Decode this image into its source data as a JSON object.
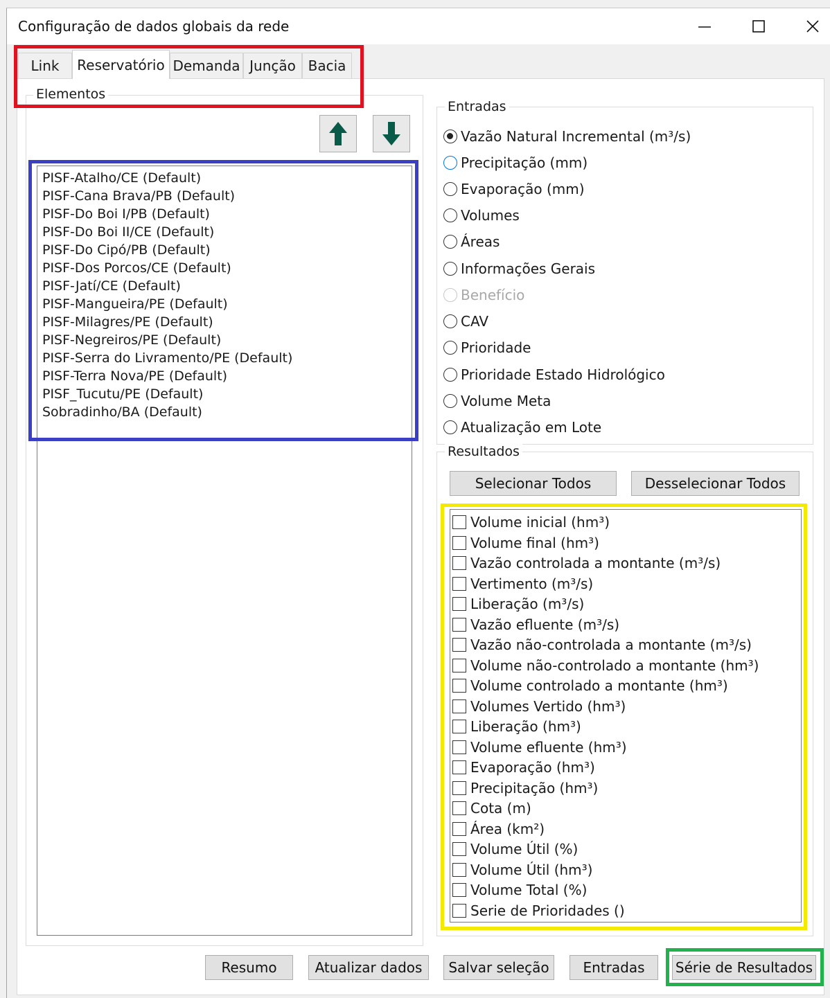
{
  "window": {
    "title": "Configuração de dados globais da rede",
    "controls": {
      "minimize": "—",
      "maximize": "☐",
      "close": "✕"
    }
  },
  "tabs": [
    {
      "label": "Link",
      "active": false
    },
    {
      "label": "Reservatório",
      "active": true
    },
    {
      "label": "Demanda",
      "active": false
    },
    {
      "label": "Junção",
      "active": false
    },
    {
      "label": "Bacia",
      "active": false
    }
  ],
  "elements": {
    "label": "Elementos",
    "move_up_icon": "arrow-up-icon",
    "move_down_icon": "arrow-down-icon",
    "items": [
      "PISF-Atalho/CE (Default)",
      "PISF-Cana Brava/PB (Default)",
      "PISF-Do Boi I/PB (Default)",
      "PISF-Do Boi II/CE (Default)",
      "PISF-Do Cipó/PB (Default)",
      "PISF-Dos Porcos/CE (Default)",
      "PISF-Jatí/CE (Default)",
      "PISF-Mangueira/PE (Default)",
      "PISF-Milagres/PE (Default)",
      "PISF-Negreiros/PE (Default)",
      "PISF-Serra do Livramento/PE (Default)",
      "PISF-Terra Nova/PE (Default)",
      "PISF_Tucutu/PE (Default)",
      "Sobradinho/BA (Default)"
    ]
  },
  "entradas": {
    "label": "Entradas",
    "options": [
      {
        "label": "Vazão Natural Incremental (m³/s)",
        "checked": true,
        "disabled": false
      },
      {
        "label": "Precipitação (mm)",
        "checked": false,
        "disabled": false
      },
      {
        "label": "Evaporação (mm)",
        "checked": false,
        "disabled": false
      },
      {
        "label": "Volumes",
        "checked": false,
        "disabled": false
      },
      {
        "label": "Áreas",
        "checked": false,
        "disabled": false
      },
      {
        "label": "Informações Gerais",
        "checked": false,
        "disabled": false
      },
      {
        "label": "Benefício",
        "checked": false,
        "disabled": true
      },
      {
        "label": "CAV",
        "checked": false,
        "disabled": false
      },
      {
        "label": "Prioridade",
        "checked": false,
        "disabled": false
      },
      {
        "label": "Prioridade Estado Hidrológico",
        "checked": false,
        "disabled": false
      },
      {
        "label": "Volume Meta",
        "checked": false,
        "disabled": false
      },
      {
        "label": "Atualização em Lote",
        "checked": false,
        "disabled": false
      }
    ]
  },
  "resultados": {
    "label": "Resultados",
    "select_all": "Selecionar Todos",
    "deselect_all": "Desselecionar Todos",
    "items": [
      "Volume inicial (hm³)",
      "Volume final (hm³)",
      "Vazão controlada a montante (m³/s)",
      "Vertimento (m³/s)",
      "Liberação (m³/s)",
      "Vazão efluente (m³/s)",
      "Vazão não-controlada a montante (m³/s)",
      "Volume não-controlado a montante (hm³)",
      "Volume controlado a montante (hm³)",
      "Volumes Vertido (hm³)",
      "Liberação (hm³)",
      "Volume efluente (hm³)",
      "Evaporação (hm³)",
      "Precipitação (hm³)",
      "Cota (m)",
      "Área (km²)",
      "Volume Útil (%)",
      "Volume Útil (hm³)",
      "Volume Total (%)",
      "Serie de Prioridades ()"
    ]
  },
  "footer": {
    "resumo": "Resumo",
    "atualizar": "Atualizar dados",
    "salvar": "Salvar seleção",
    "entradas": "Entradas",
    "serie": "Série de Resultados"
  },
  "highlight_colors": {
    "tabs": "#e0121f",
    "elements_list": "#3b3fc4",
    "results_list": "#f3ea00",
    "series_button": "#22b14c"
  }
}
